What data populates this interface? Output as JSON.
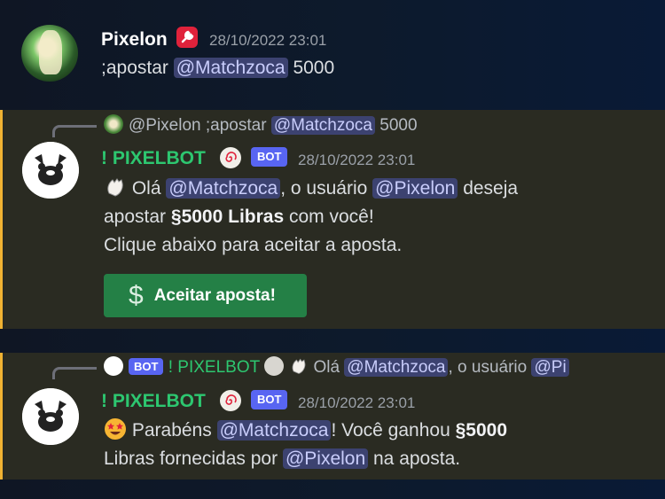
{
  "msg1": {
    "author": "Pixelon",
    "role_icon": "wrench-icon",
    "timestamp": "28/10/2022 23:01",
    "text_cmd": ";apostar",
    "mention": "@Matchzoca",
    "text_amount": "5000"
  },
  "msg2": {
    "reply": {
      "author": "@Pixelon",
      "text_cmd": ";apostar",
      "mention": "@Matchzoca",
      "text_amount": "5000"
    },
    "author": "! PIXELBOT",
    "bot_tag": "BOT",
    "timestamp": "28/10/2022 23:01",
    "line1_a": "Olá",
    "line1_mention1": "@Matchzoca",
    "line1_b": ", o usuário",
    "line1_mention2": "@Pixelon",
    "line1_c": "deseja",
    "line2_a": "apostar",
    "line2_bold": "§5000 Libras",
    "line2_b": "com você!",
    "line3": "Clique abaixo para aceitar a aposta.",
    "button_icon": "$",
    "button_label": "Aceitar aposta!"
  },
  "msg3": {
    "reply": {
      "bot_tag": "BOT",
      "author": "! PIXELBOT",
      "text_a": "Olá",
      "mention1": "@Matchzoca",
      "text_b": ", o usuário",
      "mention2": "@Pi"
    },
    "author": "! PIXELBOT",
    "bot_tag": "BOT",
    "timestamp": "28/10/2022 23:01",
    "line1_a": "Parabéns",
    "line1_mention": "@Matchzoca",
    "line1_b": "! Você ganhou",
    "line1_bold": "§5000",
    "line2_a": "Libras fornecidas por",
    "line2_mention": "@Pixelon",
    "line2_b": "na aposta."
  },
  "colors": {
    "bot_name": "#2dc770",
    "mention_bg": "#3c4270",
    "highlight_border": "#f0b232",
    "button": "#248046",
    "bot_tag": "#5865f2"
  }
}
